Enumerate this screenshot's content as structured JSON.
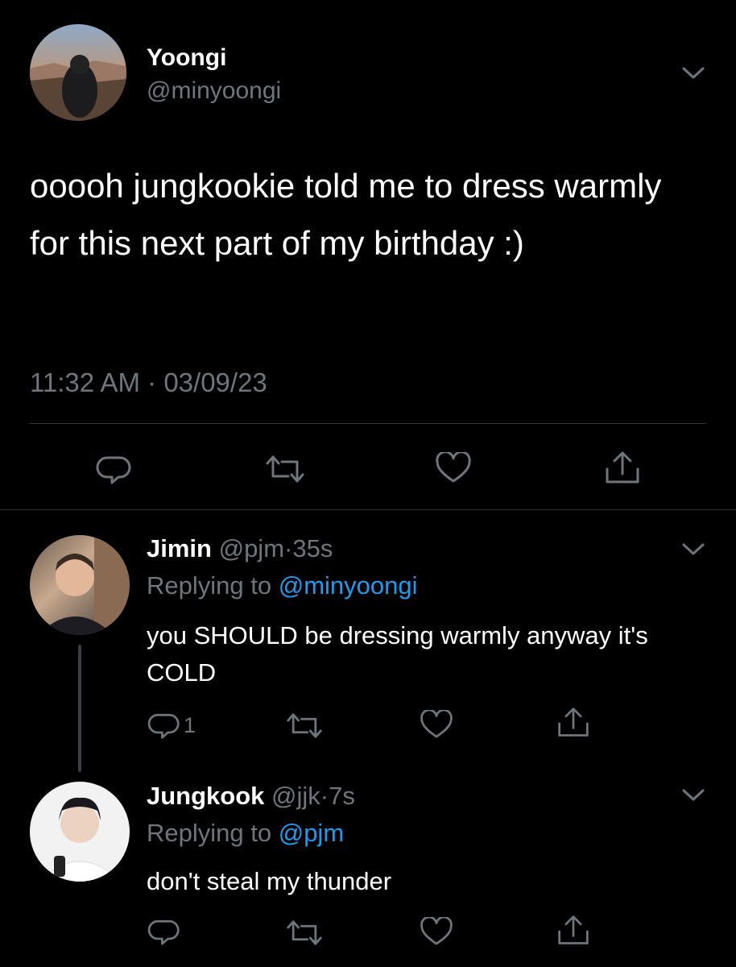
{
  "main_tweet": {
    "author_name": "Yoongi",
    "author_handle": "@minyoongi",
    "text": "ooooh jungkookie told me to dress warmly for this next part of my birthday :)",
    "time": "11:32 AM",
    "separator": "·",
    "date": "03/09/23"
  },
  "replies": [
    {
      "author_name": "Jimin",
      "author_handle": "@pjm",
      "separator": "·",
      "age": "35s",
      "replying_prefix": "Replying to",
      "replying_handle": "@minyoongi",
      "text": "you SHOULD be dressing warmly anyway it's COLD",
      "reply_count": "1"
    },
    {
      "author_name": "Jungkook",
      "author_handle": "@jjk",
      "separator": "·",
      "age": "7s",
      "replying_prefix": "Replying to",
      "replying_handle": "@pjm",
      "text": "don't steal my thunder",
      "reply_count": ""
    }
  ],
  "colors": {
    "background": "#000000",
    "muted": "#6e767d",
    "link": "#1d9bf0",
    "divider": "#2f3336"
  },
  "icons": [
    "chevron-down-icon",
    "reply-icon",
    "retweet-icon",
    "like-icon",
    "share-icon"
  ]
}
